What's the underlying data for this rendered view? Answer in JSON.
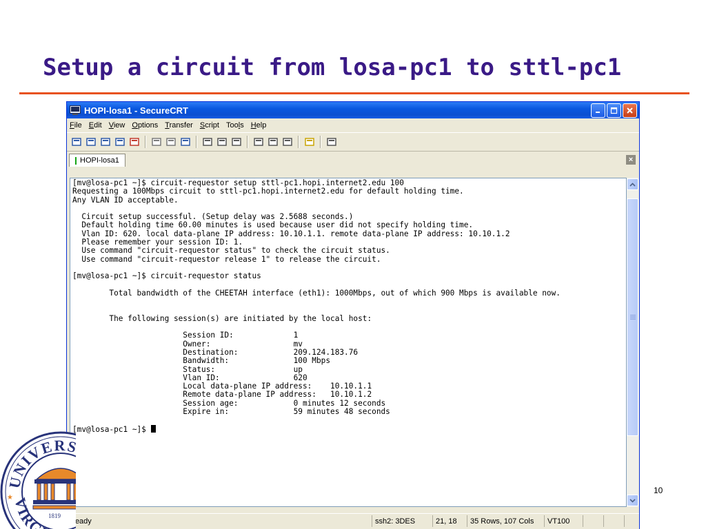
{
  "slide": {
    "title": "Setup a circuit from losa-pc1 to sttl-pc1",
    "page_number": "10"
  },
  "window": {
    "title": "HOPI-losa1 - SecureCRT",
    "menu": [
      {
        "pre": "",
        "accel": "F",
        "post": "ile"
      },
      {
        "pre": "",
        "accel": "E",
        "post": "dit"
      },
      {
        "pre": "",
        "accel": "V",
        "post": "iew"
      },
      {
        "pre": "",
        "accel": "O",
        "post": "ptions"
      },
      {
        "pre": "",
        "accel": "T",
        "post": "ransfer"
      },
      {
        "pre": "",
        "accel": "S",
        "post": "cript"
      },
      {
        "pre": "Too",
        "accel": "l",
        "post": "s"
      },
      {
        "pre": "",
        "accel": "H",
        "post": "elp"
      }
    ],
    "toolbar_icons": [
      "connect-icon",
      "quick-connect-icon",
      "connect-in-tab-icon",
      "reconnect-icon",
      "disconnect-icon",
      "copy-icon",
      "paste-icon",
      "find-icon",
      "print-icon",
      "print-selection-icon",
      "print-screen-icon",
      "session-options-icon",
      "global-options-icon",
      "keymap-icon",
      "help-icon",
      "sftp-icon"
    ],
    "tab_label": "HOPI-losa1",
    "tab_close": "×"
  },
  "terminal": {
    "lines": [
      "[mv@losa-pc1 ~]$ circuit-requestor setup sttl-pc1.hopi.internet2.edu 100",
      "Requesting a 100Mbps circuit to sttl-pc1.hopi.internet2.edu for default holding time.",
      "Any VLAN ID acceptable.",
      "",
      "  Circuit setup successful. (Setup delay was 2.5688 seconds.)",
      "  Default holding time 60.00 minutes is used because user did not specify holding time.",
      "  Vlan ID: 620. local data-plane IP address: 10.10.1.1. remote data-plane IP address: 10.10.1.2",
      "  Please remember your session ID: 1.",
      "  Use command \"circuit-requestor status\" to check the circuit status.",
      "  Use command \"circuit-requestor release 1\" to release the circuit.",
      "",
      "[mv@losa-pc1 ~]$ circuit-requestor status",
      "",
      "        Total bandwidth of the CHEETAH interface (eth1): 1000Mbps, out of which 900 Mbps is available now.",
      "",
      "",
      "        The following session(s) are initiated by the local host:",
      "",
      "                        Session ID:             1",
      "                        Owner:                  mv",
      "                        Destination:            209.124.183.76",
      "                        Bandwidth:              100 Mbps",
      "                        Status:                 up",
      "                        Vlan ID:                620",
      "                        Local data-plane IP address:    10.10.1.1",
      "                        Remote data-plane IP address:   10.10.1.2",
      "                        Session age:            0 minutes 12 seconds",
      "                        Expire in:              59 minutes 48 seconds",
      "",
      "[mv@losa-pc1 ~]$ "
    ]
  },
  "statusbar": {
    "status": "Ready",
    "protocol": "ssh2: 3DES",
    "position": "21, 18",
    "size": "35 Rows, 107 Cols",
    "emulation": "VT100"
  },
  "seal": {
    "text_top": "UNIVERSI",
    "text_bottom": "VIRGI",
    "year": "1819"
  },
  "colors": {
    "title": "#3a1a86",
    "rule": "#e8521c",
    "titlebar": "#0a58e0"
  }
}
